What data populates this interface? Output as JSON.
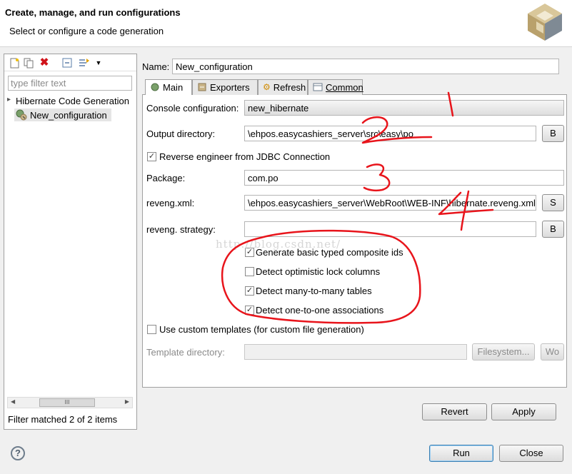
{
  "header": {
    "title": "Create, manage, and run configurations",
    "subtitle": "Select or configure a code generation"
  },
  "left": {
    "filter_placeholder": "type filter text",
    "tree": {
      "group": "Hibernate Code Generation",
      "item": "New_configuration"
    },
    "filter_status": "Filter matched 2 of 2 items",
    "scroll_glyph": "III"
  },
  "form": {
    "name_label": "Name:",
    "name_value": "New_configuration",
    "tabs": [
      {
        "label": "Main",
        "icon": "main-tab-icon"
      },
      {
        "label": "Exporters",
        "icon": "exporters-tab-icon"
      },
      {
        "label": "Refresh",
        "icon": "refresh-tab-icon"
      },
      {
        "label": "Common",
        "icon": "common-tab-icon"
      }
    ],
    "console_label": "Console configuration:",
    "console_value": "new_hibernate",
    "output_label": "Output directory:",
    "output_value": "\\ehpos.easycashiers_server\\src\\easy\\po",
    "reverse_label": "Reverse engineer from JDBC Connection",
    "package_label": "Package:",
    "package_value": "com.po",
    "reveng_xml_label": "reveng.xml:",
    "reveng_xml_value": "\\ehpos.easycashiers_server\\WebRoot\\WEB-INF\\hibernate.reveng.xml",
    "reveng_strategy_label": "reveng. strategy:",
    "reveng_strategy_value": "",
    "options": [
      {
        "label": "Generate basic typed composite ids",
        "checked": true
      },
      {
        "label": "Detect optimistic lock columns",
        "checked": false
      },
      {
        "label": "Detect many-to-many tables",
        "checked": true
      },
      {
        "label": "Detect one-to-one associations",
        "checked": true
      }
    ],
    "custom_templates_label": "Use custom templates (for custom file generation)",
    "template_dir_label": "Template directory:",
    "filesystem_button": "Filesystem...",
    "workspace_button_partial": "Wo",
    "browse_button_partial": "B",
    "setup_button_partial": "S",
    "revert_button": "Revert",
    "apply_button": "Apply"
  },
  "footer": {
    "run_button": "Run",
    "close_button": "Close",
    "help_icon": "?"
  },
  "watermark": "http://blog.csdn.net/",
  "annotations": [
    "1",
    "2",
    "3",
    "4"
  ],
  "colors": {
    "annotation_red": "#e8141b",
    "selection": "#e5e5e5"
  }
}
